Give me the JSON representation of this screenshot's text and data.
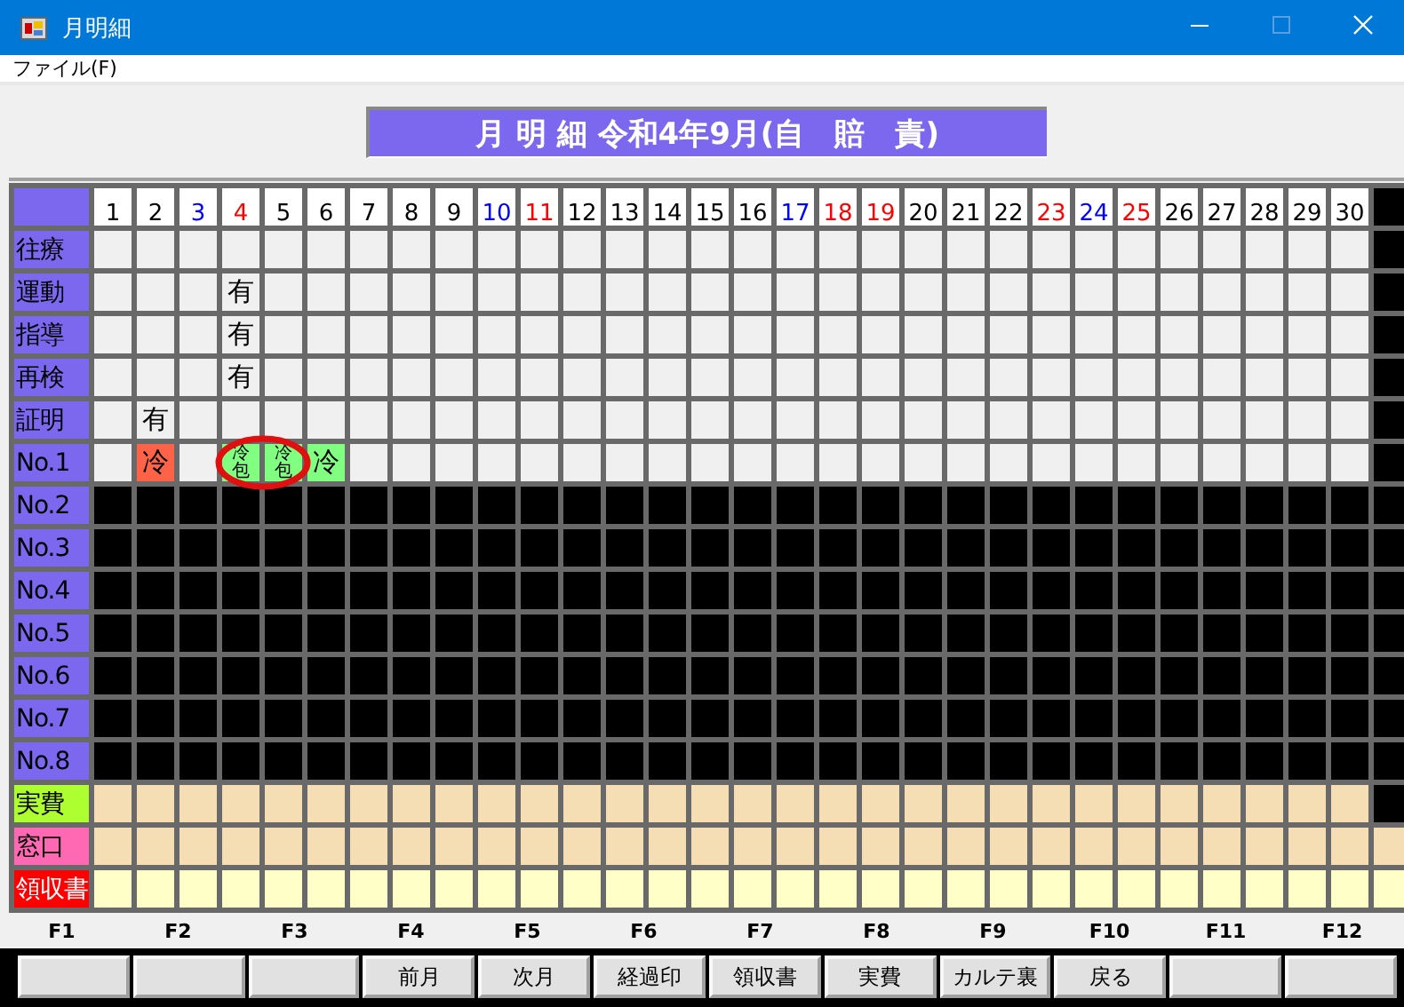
{
  "window": {
    "title": "月明細"
  },
  "menu": [
    {
      "label": "ファイル(F)"
    }
  ],
  "banner": {
    "title": "月 明 細 令和4年9月(自　賠　責)"
  },
  "days": [
    {
      "label": "1",
      "color": "#000000"
    },
    {
      "label": "2",
      "color": "#000000"
    },
    {
      "label": "3",
      "color": "#0000ff"
    },
    {
      "label": "4",
      "color": "#ff0000"
    },
    {
      "label": "5",
      "color": "#000000"
    },
    {
      "label": "6",
      "color": "#000000"
    },
    {
      "label": "7",
      "color": "#000000"
    },
    {
      "label": "8",
      "color": "#000000"
    },
    {
      "label": "9",
      "color": "#000000"
    },
    {
      "label": "10",
      "color": "#0000ff"
    },
    {
      "label": "11",
      "color": "#ff0000"
    },
    {
      "label": "12",
      "color": "#000000"
    },
    {
      "label": "13",
      "color": "#000000"
    },
    {
      "label": "14",
      "color": "#000000"
    },
    {
      "label": "15",
      "color": "#000000"
    },
    {
      "label": "16",
      "color": "#000000"
    },
    {
      "label": "17",
      "color": "#0000ff"
    },
    {
      "label": "18",
      "color": "#ff0000"
    },
    {
      "label": "19",
      "color": "#ff0000"
    },
    {
      "label": "20",
      "color": "#000000"
    },
    {
      "label": "21",
      "color": "#000000"
    },
    {
      "label": "22",
      "color": "#000000"
    },
    {
      "label": "23",
      "color": "#ff0000"
    },
    {
      "label": "24",
      "color": "#0000ff"
    },
    {
      "label": "25",
      "color": "#ff0000"
    },
    {
      "label": "26",
      "color": "#000000"
    },
    {
      "label": "27",
      "color": "#000000"
    },
    {
      "label": "28",
      "color": "#000000"
    },
    {
      "label": "29",
      "color": "#000000"
    },
    {
      "label": "30",
      "color": "#000000"
    }
  ],
  "header_extra_column_disabled": true,
  "rows": [
    {
      "label": "往療",
      "color": "#7b68ee",
      "kind": "record",
      "disabled": false,
      "extra_column_disabled": true,
      "cells": [
        {},
        {},
        {},
        {},
        {},
        {},
        {},
        {},
        {},
        {},
        {},
        {},
        {},
        {},
        {},
        {},
        {},
        {},
        {},
        {},
        {},
        {},
        {},
        {},
        {},
        {},
        {},
        {},
        {},
        {}
      ]
    },
    {
      "label": "運動",
      "color": "#7b68ee",
      "kind": "record",
      "disabled": false,
      "extra_column_disabled": true,
      "cells": [
        {},
        {},
        {},
        {
          "text": "有"
        },
        {},
        {},
        {},
        {},
        {},
        {},
        {},
        {},
        {},
        {},
        {},
        {},
        {},
        {},
        {},
        {},
        {},
        {},
        {},
        {},
        {},
        {},
        {},
        {},
        {},
        {}
      ]
    },
    {
      "label": "指導",
      "color": "#7b68ee",
      "kind": "record",
      "disabled": false,
      "extra_column_disabled": true,
      "cells": [
        {},
        {},
        {},
        {
          "text": "有"
        },
        {},
        {},
        {},
        {},
        {},
        {},
        {},
        {},
        {},
        {},
        {},
        {},
        {},
        {},
        {},
        {},
        {},
        {},
        {},
        {},
        {},
        {},
        {},
        {},
        {},
        {}
      ]
    },
    {
      "label": "再検",
      "color": "#7b68ee",
      "kind": "record",
      "disabled": false,
      "extra_column_disabled": true,
      "cells": [
        {},
        {},
        {},
        {
          "text": "有"
        },
        {},
        {},
        {},
        {},
        {},
        {},
        {},
        {},
        {},
        {},
        {},
        {},
        {},
        {},
        {},
        {},
        {},
        {},
        {},
        {},
        {},
        {},
        {},
        {},
        {},
        {}
      ]
    },
    {
      "label": "証明",
      "color": "#7b68ee",
      "kind": "record",
      "disabled": false,
      "extra_column_disabled": true,
      "cells": [
        {},
        {
          "text": "有"
        },
        {},
        {},
        {},
        {},
        {},
        {},
        {},
        {},
        {},
        {},
        {},
        {},
        {},
        {},
        {},
        {},
        {},
        {},
        {},
        {},
        {},
        {},
        {},
        {},
        {},
        {},
        {},
        {}
      ]
    },
    {
      "label": "No.1",
      "color": "#7b68ee",
      "kind": "record",
      "disabled": false,
      "extra_column_disabled": true,
      "cells": [
        {},
        {
          "text": "冷",
          "color": "#ff6347",
          "circled": false
        },
        {},
        {
          "text": "冷包",
          "stacked": true,
          "color": "#80ff80",
          "circled": true
        },
        {
          "text": "冷包",
          "stacked": true,
          "color": "#80ff80",
          "circled": true
        },
        {
          "text": "冷",
          "color": "#80ff80",
          "circled": false
        },
        {},
        {},
        {},
        {},
        {},
        {},
        {},
        {},
        {},
        {},
        {},
        {},
        {},
        {},
        {},
        {},
        {},
        {},
        {},
        {},
        {},
        {},
        {},
        {}
      ]
    },
    {
      "label": "No.2",
      "color": "#7b68ee",
      "kind": "record",
      "disabled": true,
      "extra_column_disabled": true
    },
    {
      "label": "No.3",
      "color": "#7b68ee",
      "kind": "record",
      "disabled": true,
      "extra_column_disabled": true
    },
    {
      "label": "No.4",
      "color": "#7b68ee",
      "kind": "record",
      "disabled": true,
      "extra_column_disabled": true
    },
    {
      "label": "No.5",
      "color": "#7b68ee",
      "kind": "record",
      "disabled": true,
      "extra_column_disabled": true
    },
    {
      "label": "No.6",
      "color": "#7b68ee",
      "kind": "record",
      "disabled": true,
      "extra_column_disabled": true
    },
    {
      "label": "No.7",
      "color": "#7b68ee",
      "kind": "record",
      "disabled": true,
      "extra_column_disabled": true
    },
    {
      "label": "No.8",
      "color": "#7b68ee",
      "kind": "record",
      "disabled": true,
      "extra_column_disabled": true
    },
    {
      "label": "実費",
      "color": "#adff2f",
      "kind": "amount",
      "disabled": false,
      "extra_column_disabled": true,
      "cells": [
        {},
        {},
        {},
        {},
        {},
        {},
        {},
        {},
        {},
        {},
        {},
        {},
        {},
        {},
        {},
        {},
        {},
        {},
        {},
        {},
        {},
        {},
        {},
        {},
        {},
        {},
        {},
        {},
        {},
        {}
      ]
    },
    {
      "label": "窓口",
      "color": "#ff69b4",
      "kind": "amount",
      "disabled": false,
      "extra_column_disabled": false,
      "cells": [
        {},
        {},
        {},
        {},
        {},
        {},
        {},
        {},
        {},
        {},
        {},
        {},
        {},
        {},
        {},
        {},
        {},
        {},
        {},
        {},
        {},
        {},
        {},
        {},
        {},
        {},
        {},
        {},
        {},
        {}
      ]
    },
    {
      "label": "領収書",
      "color": "#ff0000",
      "kind": "receipt",
      "disabled": false,
      "extra_column_disabled": false,
      "cells": [
        {},
        {},
        {},
        {},
        {},
        {},
        {},
        {},
        {},
        {},
        {},
        {},
        {},
        {},
        {},
        {},
        {},
        {},
        {},
        {},
        {},
        {},
        {},
        {},
        {},
        {},
        {},
        {},
        {},
        {}
      ]
    }
  ],
  "function_keys": [
    {
      "key": "F1"
    },
    {
      "key": "F2"
    },
    {
      "key": "F3"
    },
    {
      "key": "F4",
      "label": "前月"
    },
    {
      "key": "F5",
      "label": "次月"
    },
    {
      "key": "F6",
      "label": "経過印"
    },
    {
      "key": "F7",
      "label": "領収書"
    },
    {
      "key": "F8",
      "label": "実費"
    },
    {
      "key": "F9",
      "label": "カルテ裏"
    },
    {
      "key": "F10",
      "label": "戻る"
    },
    {
      "key": "F11"
    },
    {
      "key": "F12"
    }
  ]
}
